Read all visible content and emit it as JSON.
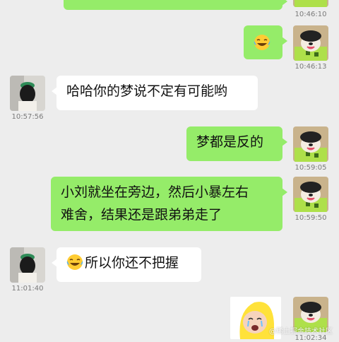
{
  "chat": {
    "messages": [
      {
        "side": "right",
        "time": "10:46:10",
        "text": ""
      },
      {
        "side": "right",
        "time": "10:46:13",
        "emoji": "face-with-tears-of-joy-icon"
      },
      {
        "side": "left",
        "time": "10:57:56",
        "text": "哈哈你的梦说不定有可能哟"
      },
      {
        "side": "right",
        "time": "10:59:05",
        "text": "梦都是反的"
      },
      {
        "side": "right",
        "time": "10:59:50",
        "line1": "小刘就坐在旁边，然后小暴左右",
        "line2": "难舍，结果还是跟弟弟走了"
      },
      {
        "side": "left",
        "time": "11:01:40",
        "text": "所以你还不把握",
        "emoji": "face-with-tears-of-joy-icon"
      },
      {
        "side": "right",
        "time": "11:02:34",
        "sticker": "crying-baby-banana-sticker"
      }
    ]
  },
  "watermark": {
    "text": "@稀土掘金技术社区"
  },
  "colors": {
    "background": "#ededed",
    "green_bubble": "#95ec69",
    "white_bubble": "#ffffff",
    "timestamp": "#7a7a7a"
  }
}
